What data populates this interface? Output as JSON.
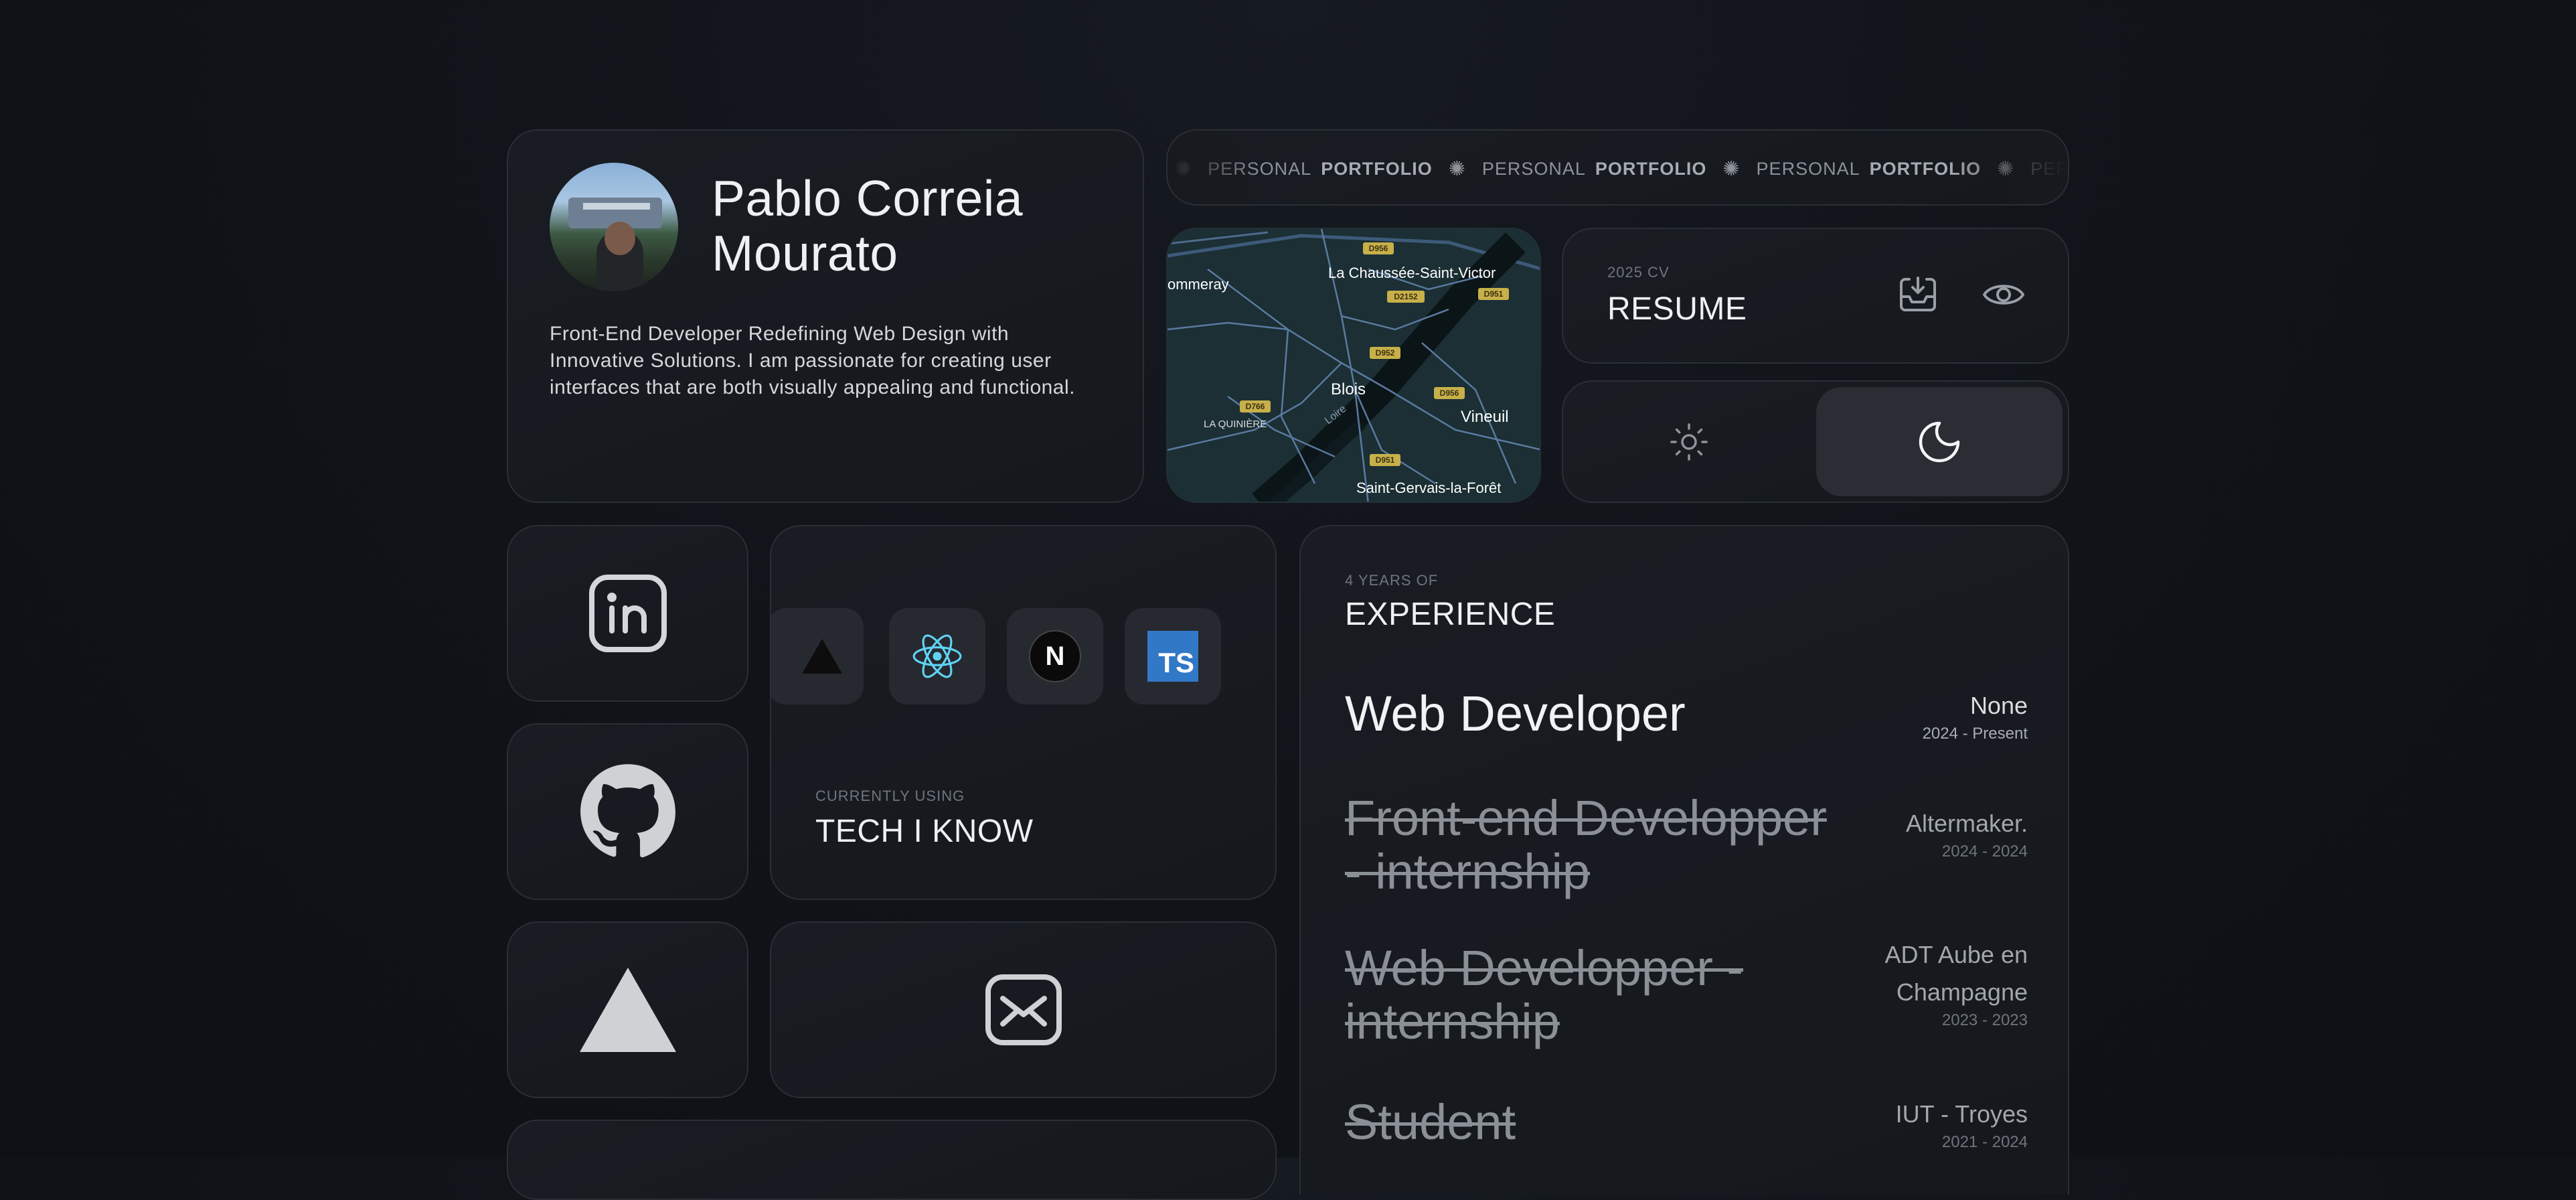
{
  "profile": {
    "name_line1": "Pablo Correia",
    "name_line2": "Mourato",
    "bio": "Front-End Developer Redefining Web Design with Innovative Solutions. I am passionate for creating user interfaces that are both visually appealing and functional."
  },
  "marquee": {
    "light_word": "PERSONAL",
    "bold_word": "PORTFOLIO",
    "separator": "✺"
  },
  "map": {
    "places": {
      "commeray": "ommeray",
      "chaussee": "La Chaussée-Saint-Victor",
      "blois": "Blois",
      "vineuil": "Vineuil",
      "quiniere": "LA QUINIÈRE",
      "gervais": "Saint-Gervais-la-Forêt",
      "loire": "Loire"
    },
    "roads": {
      "d956_top": "D956",
      "d2152": "D2152",
      "d951_top": "D951",
      "d952": "D952",
      "d956_mid": "D956",
      "d766": "D766",
      "d951_bot": "D951"
    }
  },
  "resume": {
    "overline": "2025 CV",
    "title": "RESUME",
    "icons": [
      "download-icon",
      "eye-icon"
    ]
  },
  "theme": {
    "light_icon": "sun-icon",
    "dark_icon": "moon-icon",
    "selected": "dark"
  },
  "social": {
    "linkedin_icon": "linkedin-icon",
    "github_icon": "github-icon",
    "vercel_icon": "vercel-icon",
    "mail_icon": "mail-icon"
  },
  "tech": {
    "overline": "CURRENTLY USING",
    "title": "TECH I KNOW",
    "icons": [
      "vercel-icon",
      "react-icon",
      "nextjs-icon",
      "typescript-icon"
    ],
    "ts_label": "TS",
    "next_label": "N"
  },
  "experience": {
    "overline": "4 YEARS OF",
    "title": "EXPERIENCE",
    "jobs": [
      {
        "title_l1": "Web Developer",
        "title_l2": "",
        "company_l1": "None",
        "company_l2": "",
        "dates": "2024 - Present",
        "current": true
      },
      {
        "title_l1": "Front-end Developper",
        "title_l2": "- internship",
        "company_l1": "Altermaker.",
        "company_l2": "",
        "dates": "2024 - 2024",
        "current": false
      },
      {
        "title_l1": "Web Developper -",
        "title_l2": "internship",
        "company_l1": "ADT Aube en",
        "company_l2": "Champagne",
        "dates": "2023 - 2023",
        "current": false
      },
      {
        "title_l1": "Student",
        "title_l2": "",
        "company_l1": "IUT - Troyes",
        "company_l2": "",
        "dates": "2021 - 2024",
        "current": false
      }
    ]
  }
}
